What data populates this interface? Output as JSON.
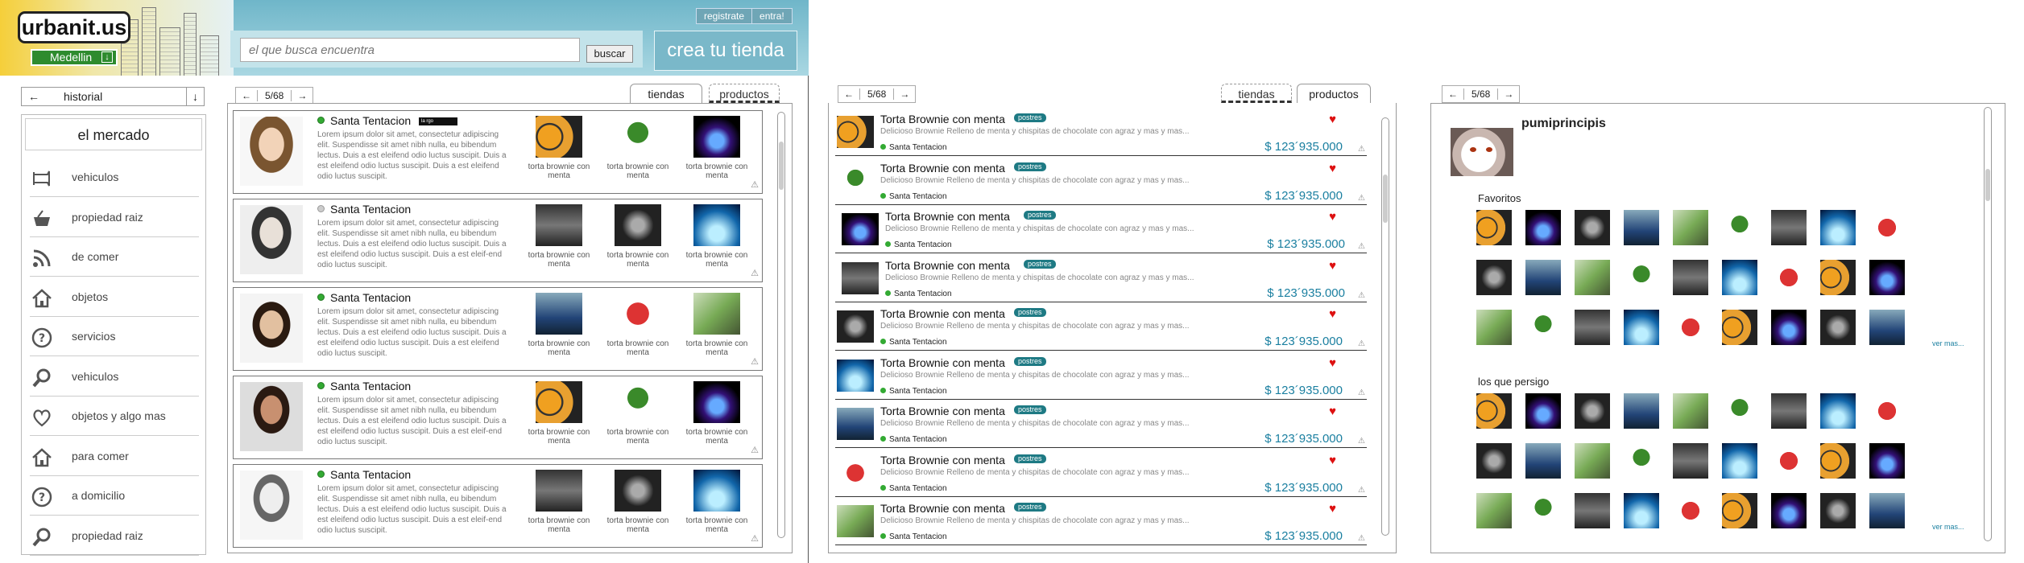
{
  "header": {
    "logo": "urbanit.us",
    "city": "Medellin",
    "search_placeholder": "el que busca encuentra",
    "search_button": "buscar",
    "register": "registrate",
    "enter": "entra!",
    "create_store": "crea tu tienda"
  },
  "sidebar": {
    "history_label": "historial",
    "market_title": "el mercado",
    "items": [
      {
        "label": "vehiculos",
        "icon": "megaphone-icon"
      },
      {
        "label": "propiedad raiz",
        "icon": "basket-icon"
      },
      {
        "label": "de comer",
        "icon": "rss-icon"
      },
      {
        "label": "objetos",
        "icon": "house-icon"
      },
      {
        "label": "servicios",
        "icon": "question-icon"
      },
      {
        "label": "vehiculos",
        "icon": "magnifier-icon"
      },
      {
        "label": "objetos y algo mas",
        "icon": "heart-icon"
      },
      {
        "label": "para comer",
        "icon": "house-icon"
      },
      {
        "label": "a domicilio",
        "icon": "question-icon"
      },
      {
        "label": "propiedad raiz",
        "icon": "magnifier-icon"
      }
    ]
  },
  "stores_view": {
    "page": "5/68",
    "tabs": {
      "stores": "tiendas",
      "products": "productos"
    },
    "cards": [
      {
        "name": "Santa Tentacion",
        "tag": "la rgo",
        "lorem": "Lorem ipsum dolor sit amet, consectetur adipiscing elit. Suspendisse sit amet nibh nulla, eu bibendum lectus. Duis a est eleifend odio luctus suscipit. Duis a est eleifend odio luctus suscipit. Duis a est eleifend odio luctus suscipit.",
        "products": [
          "torta brownie con menta",
          "torta brownie con menta",
          "torta brownie con menta"
        ]
      },
      {
        "name": "Santa Tentacion",
        "tag": "",
        "lorem": "Lorem ipsum dolor sit amet, consectetur adipiscing elit. Suspendisse sit amet nibh nulla, eu bibendum lectus. Duis a est eleifend odio luctus suscipit. Duis a est eleifend odio luctus suscipit. Duis a est eleif-end odio luctus suscipit.",
        "products": [
          "torta brownie con menta",
          "torta brownie con menta",
          "torta brownie con menta"
        ]
      },
      {
        "name": "Santa Tentacion",
        "tag": "",
        "lorem": "Lorem ipsum dolor sit amet, consectetur adipiscing elit. Suspendisse sit amet nibh nulla, eu bibendum lectus. Duis a est eleifend odio luctus suscipit. Duis a est eleifend odio luctus suscipit. Duis a est eleifend odio luctus suscipit.",
        "products": [
          "torta brownie con menta",
          "torta brownie con menta",
          "torta brownie con menta"
        ]
      },
      {
        "name": "Santa Tentacion",
        "tag": "",
        "lorem": "Lorem ipsum dolor sit amet, consectetur adipiscing elit. Suspendisse sit amet nibh nulla, eu bibendum lectus. Duis a est eleifend odio luctus suscipit. Duis a est eleifend odio luctus suscipit. Duis a est eleif-end odio luctus suscipit.",
        "products": [
          "torta brownie con menta",
          "torta brownie con menta",
          "torta brownie con menta"
        ]
      },
      {
        "name": "Santa Tentacion",
        "tag": "",
        "lorem": "Lorem ipsum dolor sit amet, consectetur adipiscing elit. Suspendisse sit amet nibh nulla, eu bibendum lectus. Duis a est eleifend odio luctus suscipit. Duis a est eleifend odio luctus suscipit. Duis a est eleif-end odio luctus suscipit.",
        "products": [
          "torta brownie con menta",
          "torta brownie con menta",
          "torta brownie con menta"
        ]
      }
    ]
  },
  "products_view": {
    "page": "5/68",
    "tabs": {
      "stores": "tiendas",
      "products": "productos"
    },
    "items": [
      {
        "title": "Torta Brownie con menta",
        "badge": "postres",
        "desc": "Delicioso Brownie Relleno de menta y chispitas de chocolate con agraz y mas y mas...",
        "store": "Santa Tentacion",
        "price": "$ 123´935.000"
      },
      {
        "title": "Torta Brownie con menta",
        "badge": "postres",
        "desc": "Delicioso Brownie Relleno de menta y chispitas de chocolate con agraz y mas y mas...",
        "store": "Santa Tentacion",
        "price": "$ 123´935.000"
      },
      {
        "title": "Torta Brownie con menta",
        "badge": "postres",
        "desc": "Delicioso Brownie Relleno de menta y chispitas de chocolate con agraz y mas y mas...",
        "store": "Santa Tentacion",
        "price": "$ 123´935.000"
      },
      {
        "title": "Torta Brownie con menta",
        "badge": "postres",
        "desc": "Delicioso Brownie Relleno de menta y chispitas de chocolate con agraz y mas y mas...",
        "store": "Santa Tentacion",
        "price": "$ 123´935.000"
      },
      {
        "title": "Torta Brownie con menta",
        "badge": "postres",
        "desc": "Delicioso Brownie Relleno de menta y chispitas de chocolate con agraz y mas y mas...",
        "store": "Santa Tentacion",
        "price": "$ 123´935.000"
      },
      {
        "title": "Torta Brownie con menta",
        "badge": "postres",
        "desc": "Delicioso Brownie Relleno de menta y chispitas de chocolate con agraz y mas y mas...",
        "store": "Santa Tentacion",
        "price": "$ 123´935.000"
      },
      {
        "title": "Torta Brownie con menta",
        "badge": "postres",
        "desc": "Delicioso Brownie Relleno de menta y chispitas de chocolate con agraz y mas y mas...",
        "store": "Santa Tentacion",
        "price": "$ 123´935.000"
      },
      {
        "title": "Torta Brownie con menta",
        "badge": "postres",
        "desc": "Delicioso Brownie Relleno de menta y chispitas de chocolate con agraz y mas y mas...",
        "store": "Santa Tentacion",
        "price": "$ 123´935.000"
      },
      {
        "title": "Torta Brownie con menta",
        "badge": "postres",
        "desc": "Delicioso Brownie Relleno de menta y chispitas de chocolate con agraz y mas y mas...",
        "store": "Santa Tentacion",
        "price": "$ 123´935.000"
      }
    ]
  },
  "profile_view": {
    "page": "5/68",
    "username": "pumiprincipis",
    "favorites_title": "Favoritos",
    "following_title": "los que persigo",
    "more": "ver mas..."
  },
  "colors": {
    "accent": "#1a7fa0",
    "badge": "#1e7a84",
    "online": "#33aa33",
    "heart": "#dd1111",
    "header": "#7ab8c9"
  }
}
